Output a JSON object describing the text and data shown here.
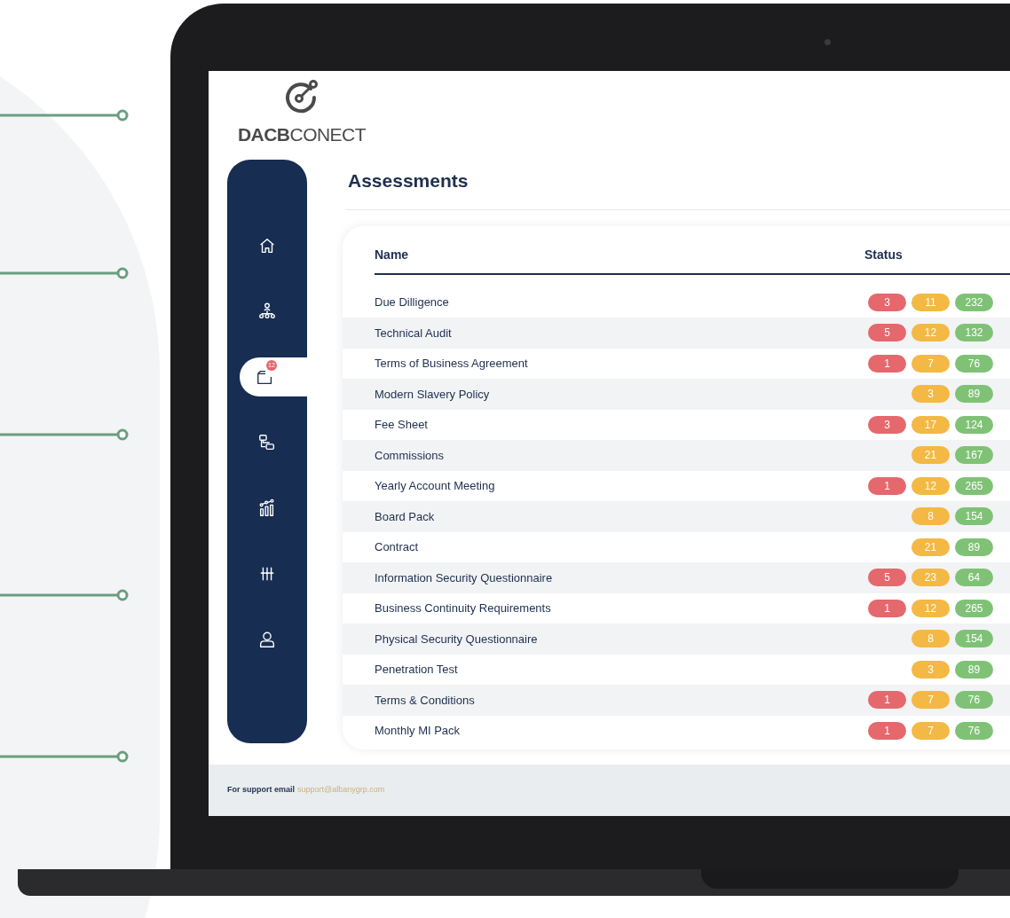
{
  "brand": {
    "logo_text": "**DACB**CONECT"
  },
  "nav": [
    {
      "kind": "home",
      "selected": false
    },
    {
      "kind": "org",
      "selected": false
    },
    {
      "kind": "folder",
      "selected": true,
      "badge": "12"
    },
    {
      "kind": "flow",
      "selected": false
    },
    {
      "kind": "chart",
      "selected": false
    },
    {
      "kind": "sliders",
      "selected": false
    },
    {
      "kind": "user",
      "selected": false
    }
  ],
  "page_title": "Assessments",
  "table": {
    "columns": [
      "Name",
      "Status"
    ],
    "rows": [
      {
        "name": "Due Dilligence",
        "high": "3",
        "medium": "11",
        "low": "232"
      },
      {
        "name": "Technical Audit",
        "high": "5",
        "medium": "12",
        "low": "132"
      },
      {
        "name": "Terms of Business Agreement",
        "high": "1",
        "medium": "7",
        "low": "76"
      },
      {
        "name": "Modern Slavery Policy",
        "medium": "3",
        "low": "89"
      },
      {
        "name": "Fee Sheet",
        "high": "3",
        "medium": "17",
        "low": "124"
      },
      {
        "name": "Commissions",
        "medium": "21",
        "low": "167"
      },
      {
        "name": "Yearly Account Meeting",
        "high": "1",
        "medium": "12",
        "low": "265"
      },
      {
        "name": "Board Pack",
        "medium": "8",
        "low": "154"
      },
      {
        "name": "Contract",
        "medium": "21",
        "low": "89"
      },
      {
        "name": "Information Security Questionnaire",
        "high": "5",
        "medium": "23",
        "low": "64"
      },
      {
        "name": "Business Continuity Requirements",
        "high": "1",
        "medium": "12",
        "low": "265"
      },
      {
        "name": "Physical Security Questionnaire",
        "medium": "8",
        "low": "154"
      },
      {
        "name": "Penetration Test",
        "medium": "3",
        "low": "89"
      },
      {
        "name": "Terms & Conditions",
        "high": "1",
        "medium": "7",
        "low": "76"
      },
      {
        "name": "Monthly MI Pack",
        "high": "1",
        "medium": "7",
        "low": "76"
      }
    ]
  },
  "footer": {
    "label": "For support email",
    "email": "support@albanygrp.com"
  }
}
